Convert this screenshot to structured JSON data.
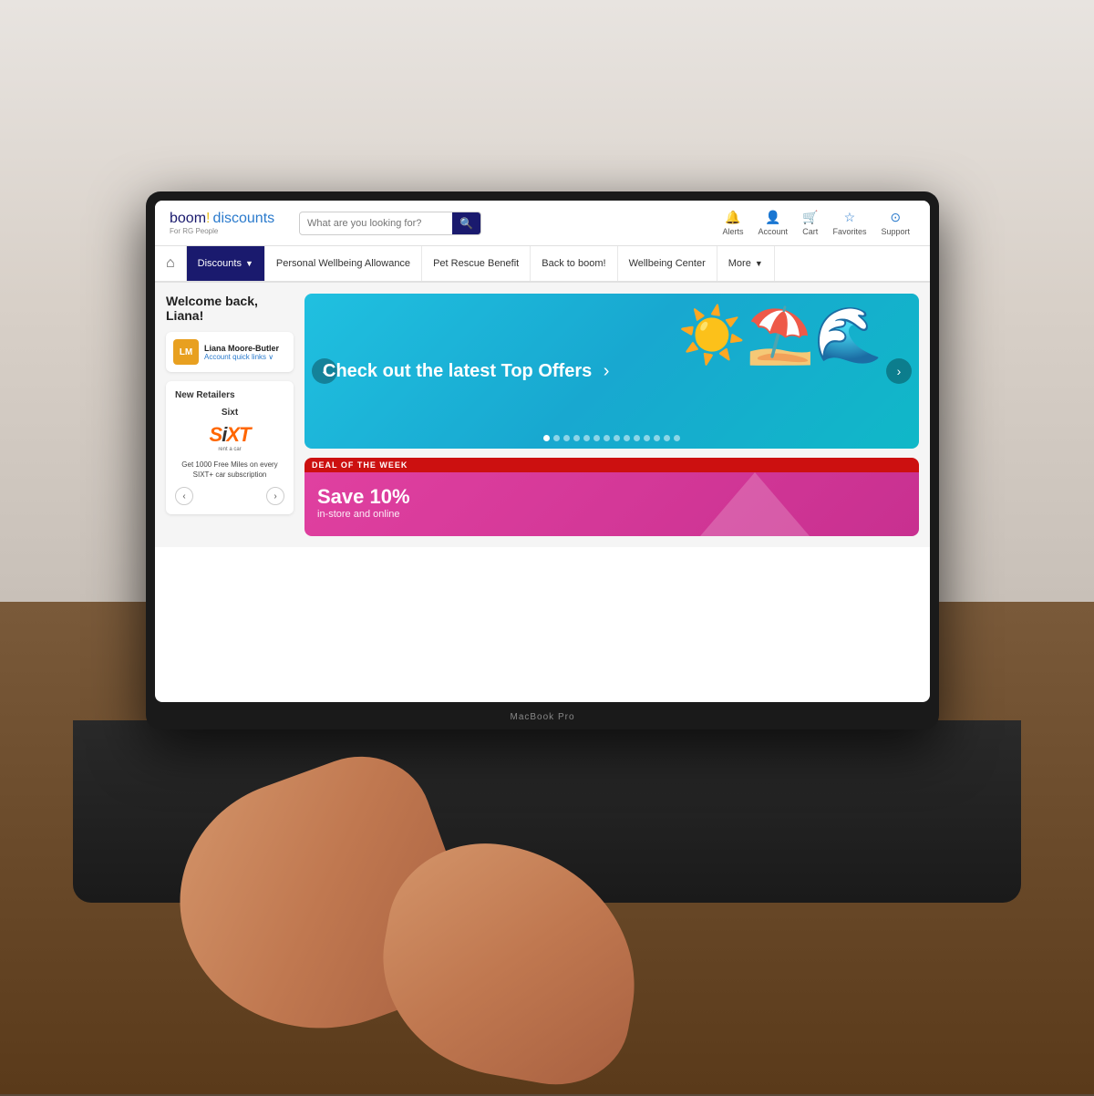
{
  "background": {
    "wall_color": "#d8d0c8",
    "desk_color": "#7a5a3a"
  },
  "laptop": {
    "brand": "MacBook Pro",
    "label": "MacBook Pro"
  },
  "website": {
    "logo": {
      "boom": "boom",
      "exclaim": "!",
      "discounts": "discounts",
      "tagline": "For RG People"
    },
    "search": {
      "placeholder": "What are you looking for?"
    },
    "nav_icons": [
      {
        "id": "alerts",
        "icon": "🔔",
        "label": "Alerts"
      },
      {
        "id": "account",
        "icon": "👤",
        "label": "Account"
      },
      {
        "id": "cart",
        "icon": "🛒",
        "label": "Cart"
      },
      {
        "id": "favorites",
        "icon": "☆",
        "label": "Favorites"
      },
      {
        "id": "support",
        "icon": "⊙",
        "label": "Support"
      }
    ],
    "nav": {
      "home_icon": "⌂",
      "items": [
        {
          "id": "discounts",
          "label": "Discounts",
          "active": true,
          "has_chevron": true
        },
        {
          "id": "pwa",
          "label": "Personal Wellbeing Allowance",
          "active": false
        },
        {
          "id": "pet",
          "label": "Pet Rescue Benefit",
          "active": false
        },
        {
          "id": "back",
          "label": "Back to boom!",
          "active": false
        },
        {
          "id": "wellbeing",
          "label": "Wellbeing Center",
          "active": false
        },
        {
          "id": "more",
          "label": "More",
          "active": false,
          "has_chevron": true
        }
      ]
    },
    "sidebar": {
      "welcome": "Welcome back, Liana!",
      "user": {
        "initials": "LM",
        "name": "Liana Moore-Butler",
        "quick_links": "Account quick links ∨"
      },
      "new_retailers": {
        "title": "New Retailers",
        "retailer_name": "Sixt",
        "logo_text": "SiXT",
        "logo_sub": "rent a car",
        "description": "Get 1000 Free Miles on every SIXT+ car subscription"
      }
    },
    "hero": {
      "text": "Check out the latest Top Offers",
      "arrow": "›",
      "dot_count": 14,
      "active_dot": 0
    },
    "deal": {
      "label": "DEAL OF THE WEEK",
      "title": "Save 10%",
      "subtitle": "in-store and online"
    }
  }
}
